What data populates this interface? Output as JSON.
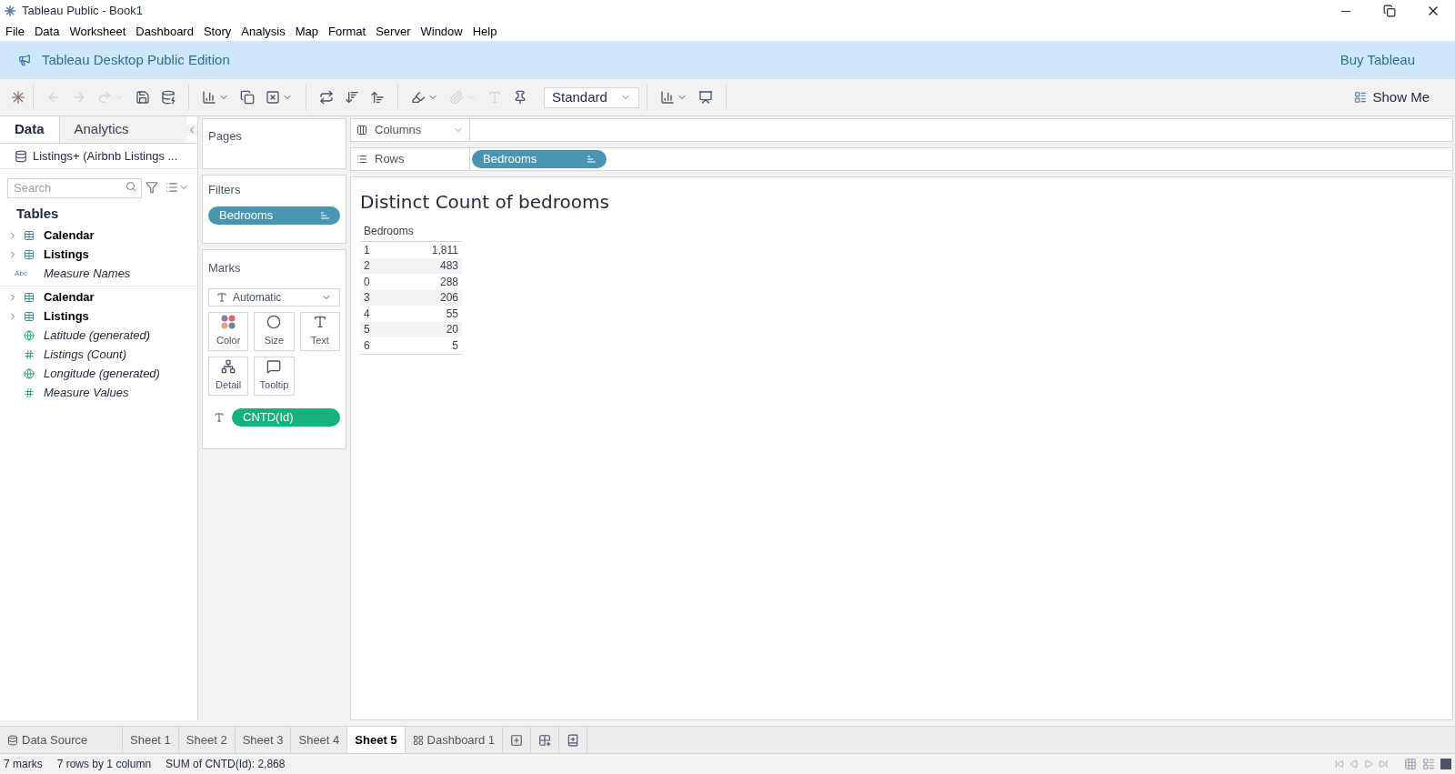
{
  "window": {
    "title": "Tableau Public - Book1"
  },
  "menu": [
    "File",
    "Data",
    "Worksheet",
    "Dashboard",
    "Story",
    "Analysis",
    "Map",
    "Format",
    "Server",
    "Window",
    "Help"
  ],
  "banner": {
    "text": "Tableau Desktop Public Edition",
    "link": "Buy Tableau"
  },
  "toolbar": {
    "fit": "Standard",
    "show_me": "Show Me"
  },
  "side_tabs": [
    {
      "label": "Data",
      "selected": true
    },
    {
      "label": "Analytics",
      "selected": false
    }
  ],
  "datasource": "Listings+ (Airbnb Listings ...",
  "search": {
    "placeholder": "Search"
  },
  "tables_heading": "Tables",
  "field_groups": [
    [
      {
        "label": "Calendar",
        "kind": "table"
      },
      {
        "label": "Listings",
        "kind": "table"
      },
      {
        "label": "Measure Names",
        "kind": "text",
        "type_label": "Abc"
      }
    ],
    [
      {
        "label": "Calendar",
        "kind": "table"
      },
      {
        "label": "Listings",
        "kind": "table"
      },
      {
        "label": "Latitude (generated)",
        "kind": "geo"
      },
      {
        "label": "Listings (Count)",
        "kind": "number"
      },
      {
        "label": "Longitude (generated)",
        "kind": "geo"
      },
      {
        "label": "Measure Values",
        "kind": "number"
      }
    ]
  ],
  "pages": {
    "title": "Pages"
  },
  "filters": {
    "title": "Filters",
    "pills": [
      "Bedrooms"
    ]
  },
  "marks": {
    "title": "Marks",
    "type": "Automatic",
    "cards": [
      "Color",
      "Size",
      "Text",
      "Detail",
      "Tooltip"
    ],
    "pill": "CNTD(Id)"
  },
  "shelves": [
    {
      "label": "Columns",
      "kind": "columns"
    },
    {
      "label": "Rows",
      "kind": "rows",
      "pill": "Bedrooms"
    }
  ],
  "view": {
    "title": "Distinct Count of bedrooms",
    "header": "Bedrooms",
    "rows": [
      {
        "key": "1",
        "value": "1,811"
      },
      {
        "key": "2",
        "value": "483"
      },
      {
        "key": "0",
        "value": "288"
      },
      {
        "key": "3",
        "value": "206"
      },
      {
        "key": "4",
        "value": "55"
      },
      {
        "key": "5",
        "value": "20"
      },
      {
        "key": "6",
        "value": "5"
      }
    ]
  },
  "sheet_tabs": [
    {
      "label": "Data Source",
      "kind": "datasource",
      "selected": false
    },
    {
      "label": "Sheet 1",
      "kind": "sheet",
      "selected": false
    },
    {
      "label": "Sheet 2",
      "kind": "sheet",
      "selected": false
    },
    {
      "label": "Sheet 3",
      "kind": "sheet",
      "selected": false
    },
    {
      "label": "Sheet 4",
      "kind": "sheet",
      "selected": false
    },
    {
      "label": "Sheet 5",
      "kind": "sheet",
      "selected": true
    },
    {
      "label": "Dashboard 1",
      "kind": "dashboard",
      "selected": false
    }
  ],
  "status_bar": [
    "7 marks",
    "7 rows by 1 column",
    "SUM of CNTD(Id): 2,868"
  ]
}
